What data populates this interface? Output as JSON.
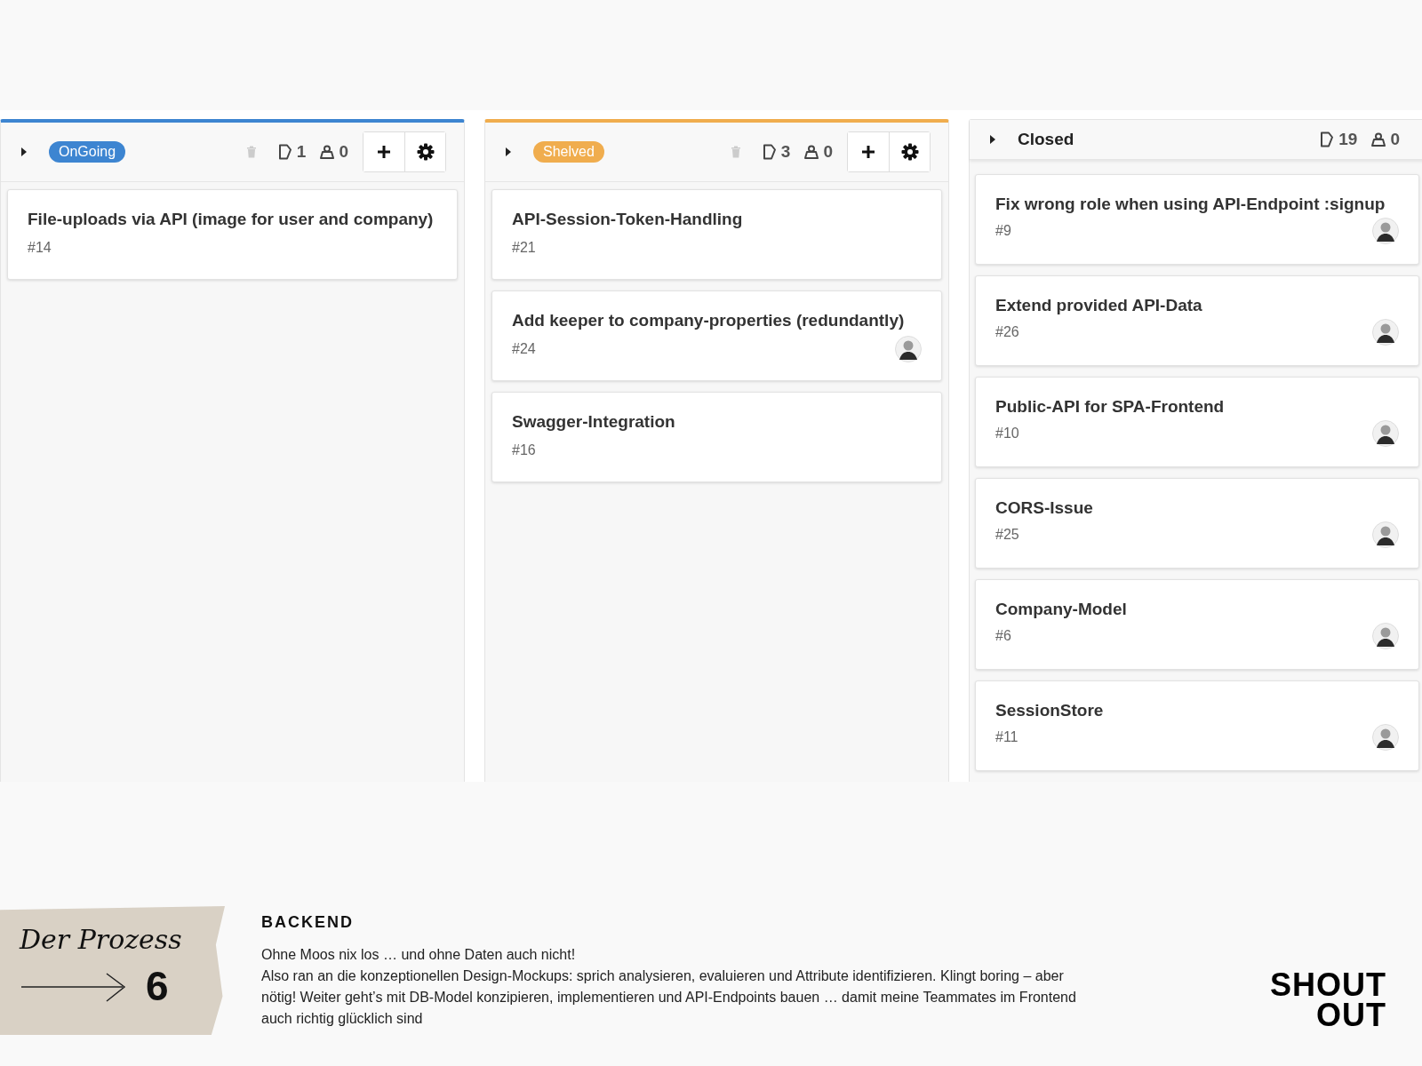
{
  "board": {
    "columns": [
      {
        "kind": "badge",
        "title": "OnGoing",
        "color": "#3d85d1",
        "controls": true,
        "cards_count": "1",
        "people_count": "0",
        "cards": [
          {
            "title": "File-uploads via API (image for user and company)",
            "number": "#14",
            "assigned": false
          }
        ]
      },
      {
        "kind": "badge",
        "title": "Shelved",
        "color": "#f0ad4e",
        "controls": true,
        "cards_count": "3",
        "people_count": "0",
        "cards": [
          {
            "title": "API-Session-Token-Handling",
            "number": "#21",
            "assigned": false
          },
          {
            "title": "Add keeper to company-properties (redundantly)",
            "number": "#24",
            "assigned": true
          },
          {
            "title": "Swagger-Integration",
            "number": "#16",
            "assigned": false
          }
        ]
      },
      {
        "kind": "plain",
        "title": "Closed",
        "controls": false,
        "cards_count": "19",
        "people_count": "0",
        "cards": [
          {
            "title": "Fix wrong role when using API-Endpoint :signup",
            "number": "#9",
            "assigned": true
          },
          {
            "title": "Extend provided API-Data",
            "number": "#26",
            "assigned": true
          },
          {
            "title": "Public-API for SPA-Frontend",
            "number": "#10",
            "assigned": true
          },
          {
            "title": "CORS-Issue",
            "number": "#25",
            "assigned": true
          },
          {
            "title": "Company-Model",
            "number": "#6",
            "assigned": true
          },
          {
            "title": "SessionStore",
            "number": "#11",
            "assigned": true
          }
        ]
      }
    ]
  },
  "footer": {
    "tape_title": "Der Prozess",
    "step": "6",
    "heading": "BACKEND",
    "paragraphs": [
      "Ohne Moos nix los … und ohne Daten auch nicht!",
      "Also ran an die konzeptionellen Design-Mockups: sprich analysieren, evaluieren und Attribute identifizieren. Klingt boring – aber nötig! Weiter geht’s mit DB-Model konzipieren, implementieren und API-Endpoints bauen … damit meine Teammates im Frontend auch richtig glücklich sind"
    ],
    "logo": [
      "SHOUT",
      "OUT"
    ]
  }
}
